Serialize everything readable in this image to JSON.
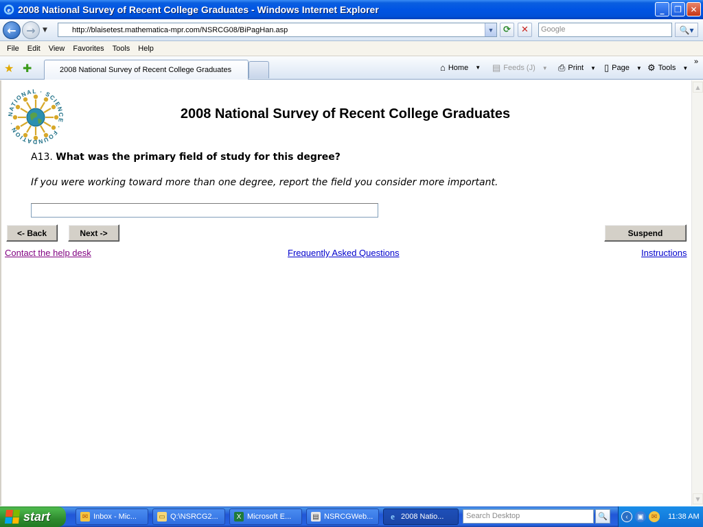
{
  "window": {
    "title": "2008 National Survey of Recent College Graduates - Windows Internet Explorer",
    "min_icon": "minimize-icon",
    "max_icon": "maximize-icon",
    "close_icon": "close-icon"
  },
  "address_bar": {
    "url": "http://blaisetest.mathematica-mpr.com/NSRCG08/BiPagHan.asp",
    "search_placeholder": "Google"
  },
  "menu": [
    "File",
    "Edit",
    "View",
    "Favorites",
    "Tools",
    "Help"
  ],
  "tab": {
    "label": "2008 National Survey of Recent College Graduates"
  },
  "command_bar": {
    "home": "Home",
    "feeds": "Feeds (J)",
    "print": "Print",
    "page": "Page",
    "tools": "Tools"
  },
  "page": {
    "logo_text": "NATIONAL SCIENCE FOUNDATION",
    "title": "2008 National Survey of Recent College Graduates",
    "question_number": "A13.",
    "question_text": "What was the primary field of study for this degree?",
    "instruction": "If you were working toward more than one degree, report the field you consider more important.",
    "answer_value": "",
    "back_label": "<- Back",
    "next_label": "Next ->",
    "suspend_label": "Suspend",
    "help_link": "Contact the help desk",
    "faq_link": "Frequently Asked Questions",
    "instructions_link": "Instructions"
  },
  "taskbar": {
    "start_label": "start",
    "tasks": [
      {
        "label": "Inbox - Mic...",
        "icon": "outlook-icon"
      },
      {
        "label": "Q:\\NSRCG2...",
        "icon": "folder-icon"
      },
      {
        "label": "Microsoft E...",
        "icon": "excel-icon"
      },
      {
        "label": "NSRCGWeb...",
        "icon": "document-icon"
      },
      {
        "label": "2008 Natio...",
        "icon": "ie-icon"
      }
    ],
    "search_placeholder": "Search Desktop",
    "clock": "11:38 AM"
  },
  "colors": {
    "visited_link": "#800080",
    "link": "#0000cc",
    "titlebar": "#0054e3",
    "taskbar": "#2157d7"
  }
}
